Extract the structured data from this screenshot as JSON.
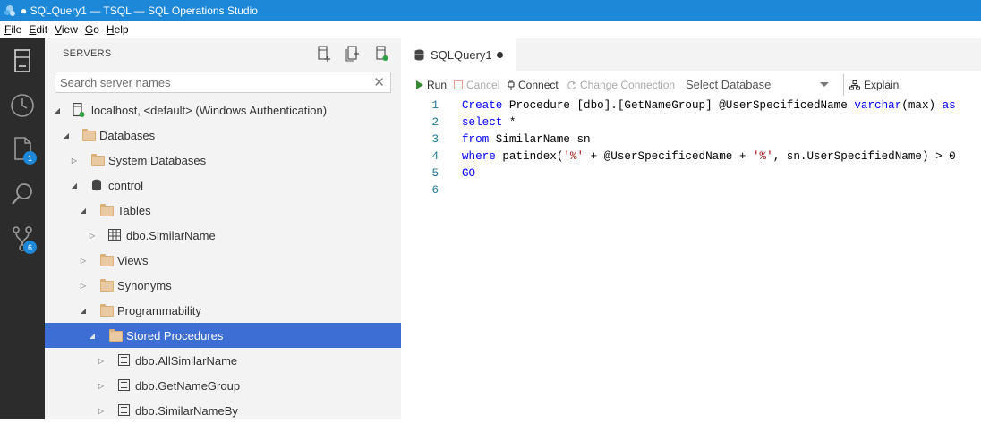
{
  "window": {
    "title": "● SQLQuery1 — TSQL — SQL Operations Studio"
  },
  "menu": [
    {
      "label": "File",
      "accel": "F",
      "rest": "ile"
    },
    {
      "label": "Edit",
      "accel": "E",
      "rest": "dit"
    },
    {
      "label": "View",
      "accel": "V",
      "rest": "iew"
    },
    {
      "label": "Go",
      "accel": "G",
      "rest": "o"
    },
    {
      "label": "Help",
      "accel": "H",
      "rest": "elp"
    }
  ],
  "activity": {
    "items": [
      "servers-icon",
      "history-icon",
      "explorer-icon",
      "search-icon",
      "source-control-icon"
    ],
    "explorer_badge": "1",
    "scm_badge": "6"
  },
  "sidebar": {
    "header": "SERVERS",
    "search_placeholder": "Search server names",
    "clear": "✕",
    "tree": [
      {
        "label": "localhost, <default> (Windows Authentication)",
        "state": "expanded",
        "icon": "server-icon"
      },
      {
        "label": "Databases",
        "state": "expanded",
        "icon": "folder-icon"
      },
      {
        "label": "System Databases",
        "state": "collapsed",
        "icon": "folder-icon"
      },
      {
        "label": "control",
        "state": "expanded",
        "icon": "database-icon"
      },
      {
        "label": "Tables",
        "state": "expanded",
        "icon": "folder-icon"
      },
      {
        "label": "dbo.SimilarName",
        "state": "collapsed",
        "icon": "table-icon"
      },
      {
        "label": "Views",
        "state": "collapsed",
        "icon": "folder-icon"
      },
      {
        "label": "Synonyms",
        "state": "collapsed",
        "icon": "folder-icon"
      },
      {
        "label": "Programmability",
        "state": "expanded",
        "icon": "folder-icon"
      },
      {
        "label": "Stored Procedures",
        "state": "expanded",
        "icon": "folder-icon",
        "selected": true
      },
      {
        "label": "dbo.AllSimilarName",
        "state": "collapsed",
        "icon": "procedure-icon"
      },
      {
        "label": "dbo.GetNameGroup",
        "state": "collapsed",
        "icon": "procedure-icon"
      },
      {
        "label": "dbo.SimilarNameBy",
        "state": "collapsed",
        "icon": "procedure-icon"
      }
    ]
  },
  "editor": {
    "tab_label": "SQLQuery1",
    "toolbar": {
      "run": "Run",
      "cancel": "Cancel",
      "connect": "Connect",
      "change_connection": "Change Connection",
      "select_database": "Select Database",
      "explain": "Explain"
    },
    "lines": [
      {
        "n": "1",
        "tokens": [
          [
            "kw",
            "Create"
          ],
          [
            "t",
            " Procedure [dbo].[GetNameGroup] @UserSpecificedName "
          ],
          [
            "kw",
            "varchar"
          ],
          [
            "t",
            "(max) "
          ],
          [
            "kw",
            "as"
          ]
        ]
      },
      {
        "n": "2",
        "tokens": [
          [
            "kw",
            "select"
          ],
          [
            "t",
            " *"
          ]
        ]
      },
      {
        "n": "3",
        "tokens": [
          [
            "kw",
            "from"
          ],
          [
            "t",
            " SimilarName sn"
          ]
        ]
      },
      {
        "n": "4",
        "tokens": [
          [
            "kw",
            "where"
          ],
          [
            "t",
            " patindex("
          ],
          [
            "str",
            "'%'"
          ],
          [
            "t",
            " + @UserSpecificedName + "
          ],
          [
            "str",
            "'%'"
          ],
          [
            "t",
            ", sn.UserSpecifiedName) > 0"
          ]
        ]
      },
      {
        "n": "5",
        "tokens": [
          [
            "kw",
            "GO"
          ]
        ]
      },
      {
        "n": "6",
        "tokens": []
      }
    ]
  },
  "colors": {
    "accent": "#1e88d8",
    "selection": "#3c6ed4",
    "keyword": "#0000ff",
    "string": "#a31515",
    "run": "#388a34"
  }
}
